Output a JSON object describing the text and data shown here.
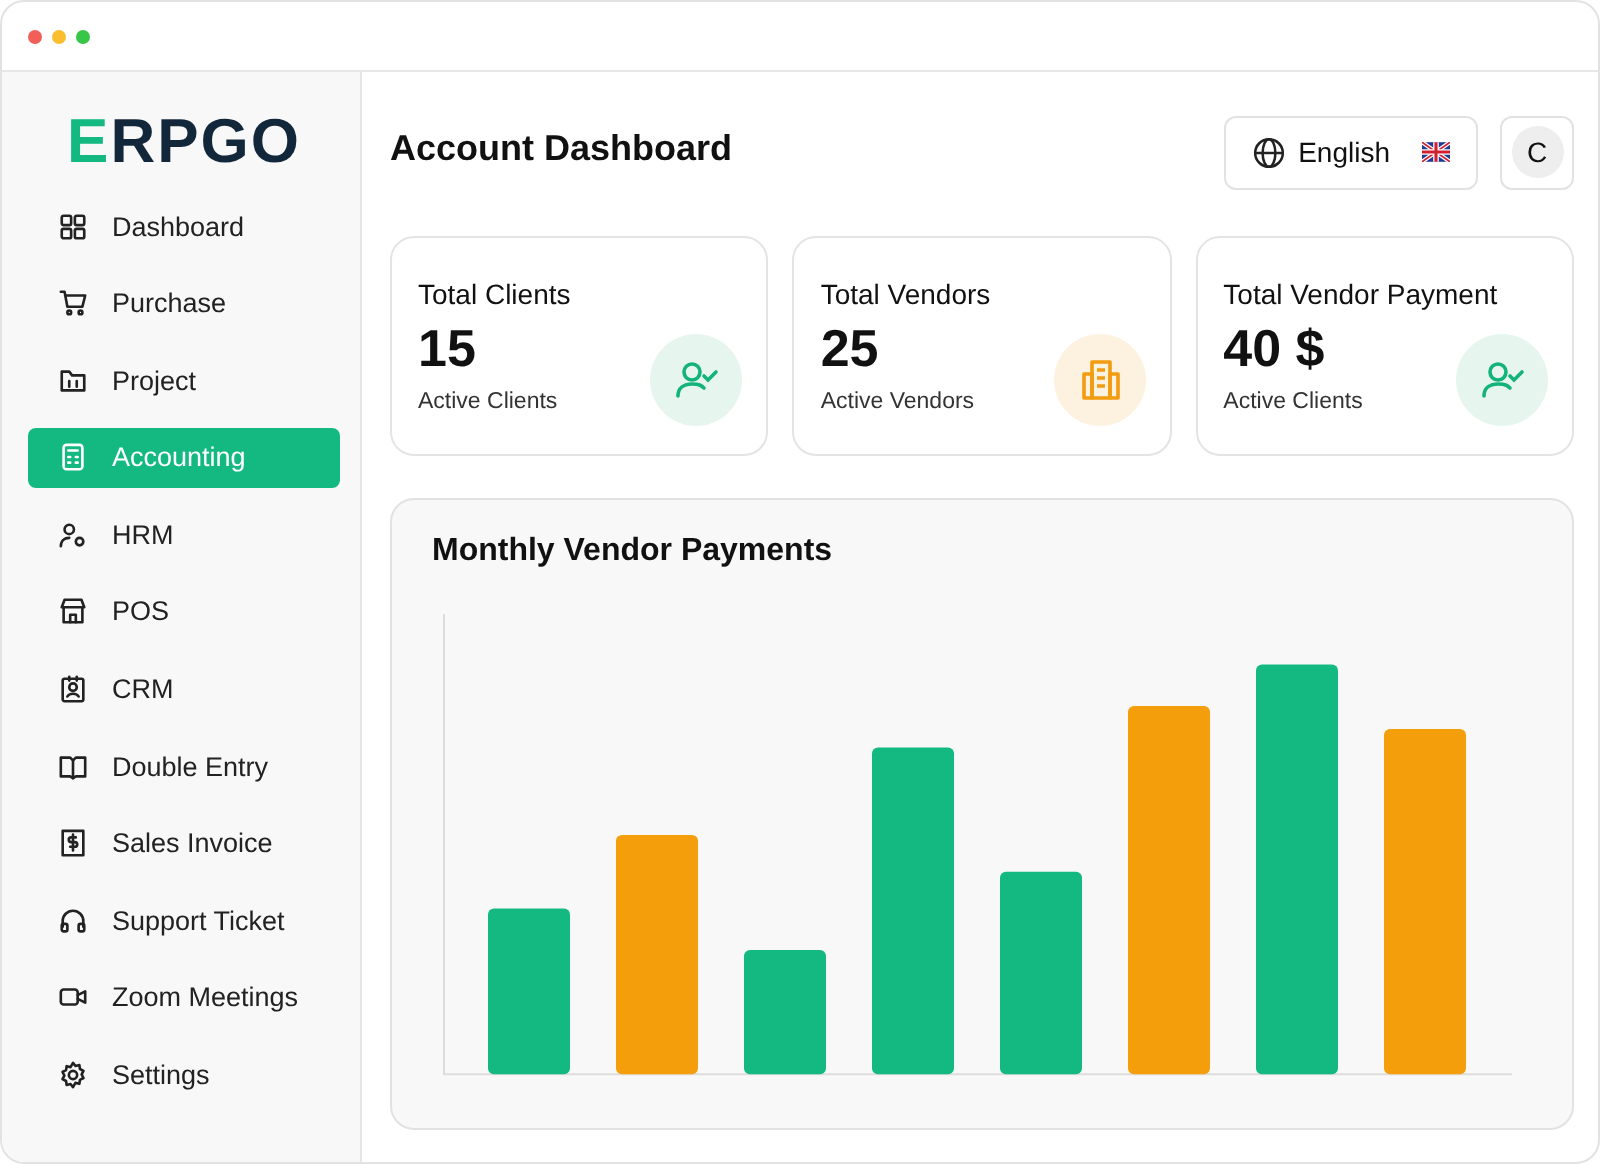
{
  "logo": {
    "accent": "E",
    "rest": "RPGO"
  },
  "sidebar": {
    "items": [
      {
        "label": "Dashboard",
        "selected": false
      },
      {
        "label": "Purchase",
        "selected": false
      },
      {
        "label": "Project",
        "selected": false
      },
      {
        "label": "Accounting",
        "selected": true
      },
      {
        "label": "HRM",
        "selected": false
      },
      {
        "label": "POS",
        "selected": false
      },
      {
        "label": "CRM",
        "selected": false
      },
      {
        "label": "Double Entry",
        "selected": false
      },
      {
        "label": "Sales Invoice",
        "selected": false
      },
      {
        "label": "Support Ticket",
        "selected": false
      },
      {
        "label": "Zoom Meetings",
        "selected": false
      },
      {
        "label": "Settings",
        "selected": false
      }
    ]
  },
  "header": {
    "title": "Account Dashboard",
    "language": "English",
    "avatar": "C"
  },
  "cards": [
    {
      "title": "Total Clients",
      "value": "15",
      "caption": "Active Clients",
      "kind": "client"
    },
    {
      "title": "Total Vendors",
      "value": "25",
      "caption": "Active Vendors",
      "kind": "vendor"
    },
    {
      "title": "Total Vendor Payment",
      "value": "40 $",
      "caption": "Active Clients",
      "kind": "client"
    }
  ],
  "chart": {
    "title": "Monthly Vendor Payments",
    "kind": "picture"
  }
}
